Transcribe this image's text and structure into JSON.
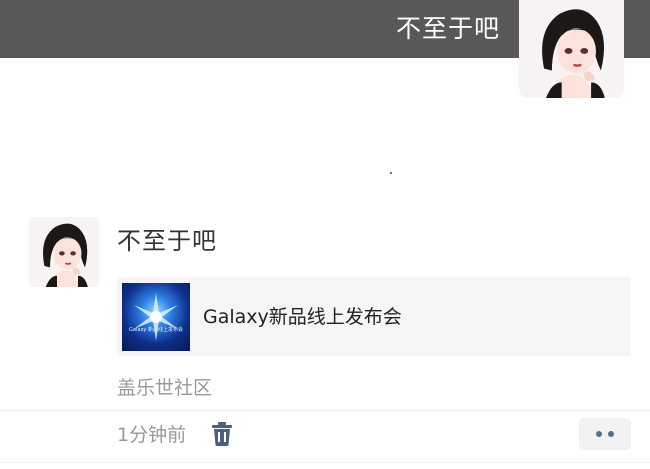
{
  "header": {
    "title": "不至于吧"
  },
  "post": {
    "text": "不至于吧",
    "link_card": {
      "title": "Galaxy新品线上发布会",
      "thumbnail_caption": "Galaxy 新品线上发布会",
      "thumbnail_icon": "galaxy-event-thumbnail"
    },
    "community": "盖乐世社区",
    "time": "1分钟前"
  },
  "icons": {
    "delete": "trash-icon",
    "more": "more-dots-icon"
  },
  "colors": {
    "header_bg": "#585858",
    "more_dots": "#5a6b8c",
    "delete_icon": "#4a5f86"
  }
}
